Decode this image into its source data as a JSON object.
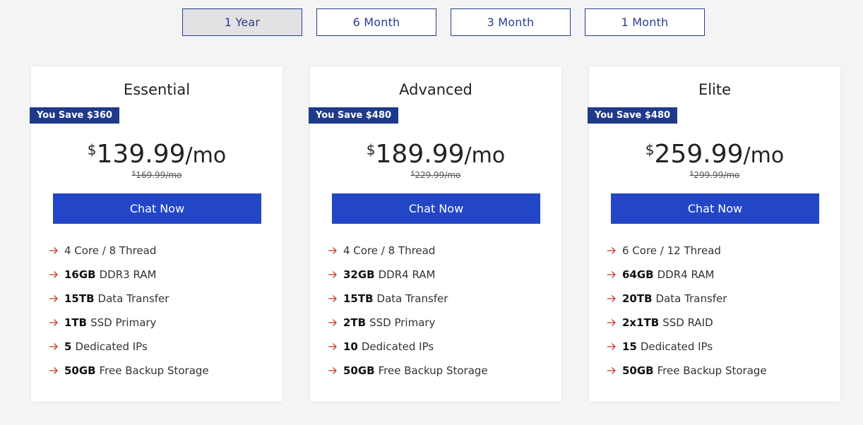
{
  "periods": [
    {
      "label": "1 Year"
    },
    {
      "label": "6 Month"
    },
    {
      "label": "3 Month"
    },
    {
      "label": "1 Month"
    }
  ],
  "selected_period": "1 Year",
  "plans": [
    {
      "name": "Essential",
      "save": "You Save $360",
      "currency": "$",
      "price": "139.99",
      "per": "/mo",
      "old_price": "169.99/mo",
      "cta": "Chat Now",
      "features": [
        {
          "bold": "",
          "text": "4 Core / 8 Thread"
        },
        {
          "bold": "16GB",
          "text": "DDR3 RAM"
        },
        {
          "bold": "15TB",
          "text": "Data Transfer"
        },
        {
          "bold": "1TB",
          "text": "SSD Primary"
        },
        {
          "bold": "5",
          "text": "Dedicated IPs"
        },
        {
          "bold": "50GB",
          "text": "Free Backup Storage"
        }
      ]
    },
    {
      "name": "Advanced",
      "save": "You Save $480",
      "currency": "$",
      "price": "189.99",
      "per": "/mo",
      "old_price": "229.99/mo",
      "cta": "Chat Now",
      "features": [
        {
          "bold": "",
          "text": "4 Core / 8 Thread"
        },
        {
          "bold": "32GB",
          "text": "DDR4 RAM"
        },
        {
          "bold": "15TB",
          "text": "Data Transfer"
        },
        {
          "bold": "2TB",
          "text": "SSD Primary"
        },
        {
          "bold": "10",
          "text": "Dedicated IPs"
        },
        {
          "bold": "50GB",
          "text": "Free Backup Storage"
        }
      ]
    },
    {
      "name": "Elite",
      "save": "You Save $480",
      "currency": "$",
      "price": "259.99",
      "per": "/mo",
      "old_price": "299.99/mo",
      "cta": "Chat Now",
      "features": [
        {
          "bold": "",
          "text": "6 Core / 12 Thread"
        },
        {
          "bold": "64GB",
          "text": "DDR4 RAM"
        },
        {
          "bold": "20TB",
          "text": "Data Transfer"
        },
        {
          "bold": "2x1TB",
          "text": "SSD RAID"
        },
        {
          "bold": "15",
          "text": "Dedicated IPs"
        },
        {
          "bold": "50GB",
          "text": "Free Backup Storage"
        }
      ]
    }
  ],
  "colors": {
    "accent": "#2346c7",
    "badge": "#1f3a8a",
    "tab_border": "#2a3d8f",
    "arrow": "#c0392b"
  },
  "icons": {
    "feature_bullet": "arrow-right-icon"
  }
}
